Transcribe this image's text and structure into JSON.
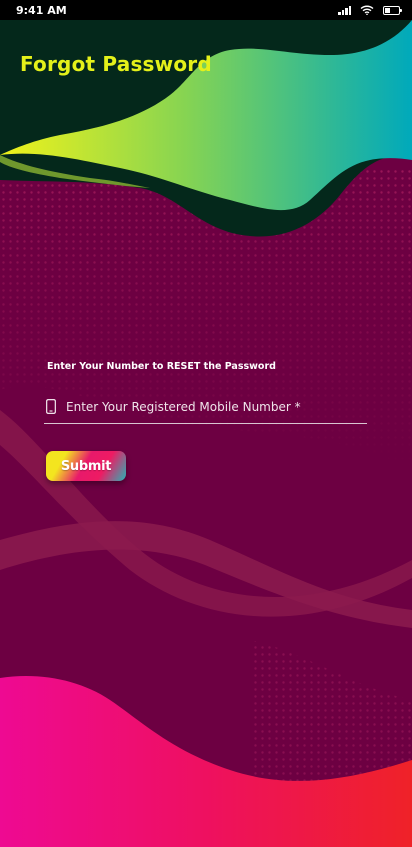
{
  "status_bar": {
    "time": "9:41 AM",
    "icons": [
      "signal-icon",
      "wifi-icon",
      "battery-icon"
    ]
  },
  "header": {
    "title": "Forgot Password"
  },
  "form": {
    "instruction": "Enter Your Number to RESET the Password",
    "mobile_placeholder": "Enter Your Registered Mobile Number *",
    "mobile_value": "",
    "field_icon": "phone-icon",
    "submit_label": "Submit"
  },
  "colors": {
    "background": "#6d0042",
    "title": "#e4f11a",
    "header_dark": "#04281b",
    "wave_yellow": "#eef21c",
    "wave_green": "#6fd060",
    "wave_teal": "#0fb0b8",
    "footer_pink": "#ec0b8c",
    "footer_red": "#ef2129"
  }
}
